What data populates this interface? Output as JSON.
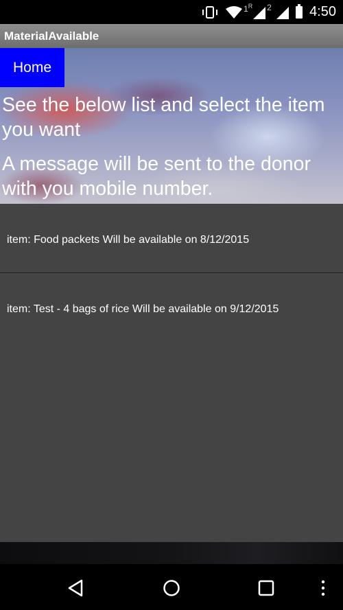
{
  "status_bar": {
    "time": "4:50",
    "sim1_label": "1",
    "sim1_roaming": "R",
    "sim2_label": "2",
    "icons": [
      "vibrate-icon",
      "wifi-icon",
      "signal-icon",
      "signal-icon",
      "battery-icon"
    ]
  },
  "app_bar": {
    "title": "MaterialAvailable"
  },
  "home_button": {
    "label": "Home"
  },
  "instructions": {
    "line1": "See the below list and select the item you want",
    "line2": "A message will be sent to the donor with you mobile number."
  },
  "items": [
    {
      "text": "item: Food packets Will be available on 8/12/2015"
    },
    {
      "text": "item: Test - 4 bags of rice Will be available on 9/12/2015"
    }
  ],
  "nav_bar": {
    "icons": [
      "back-icon",
      "home-icon",
      "recent-apps-icon",
      "menu-icon"
    ]
  }
}
